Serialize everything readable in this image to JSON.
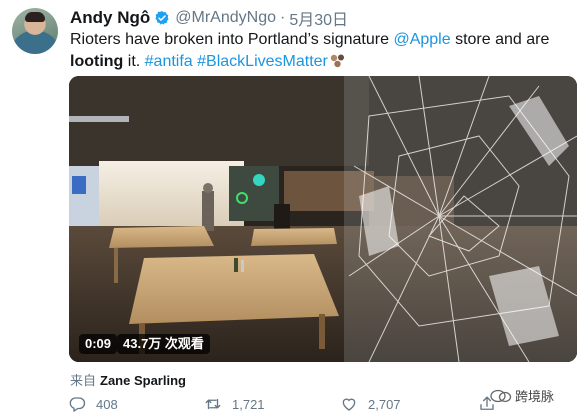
{
  "tweet": {
    "author_name": "Andy Ngô",
    "handle": "@MrAndyNgo",
    "separator": "·",
    "date": "5月30日",
    "text_parts": {
      "p1": "Rioters have broken into Portland’s signature ",
      "mention": "@Apple",
      "p2": " store and are ",
      "bold": "looting",
      "p3": " it. ",
      "hashtag1": "#antifa",
      "hashtag2": "#BlackLivesMatter"
    },
    "video": {
      "time": "0:09",
      "views": "43.7万 次观看"
    },
    "attribution_prefix": "来自",
    "attribution_name": "Zane Sparling",
    "counts": {
      "replies": "408",
      "retweets": "1,721",
      "likes": "2,707"
    }
  },
  "watermark": "跨境脉",
  "colors": {
    "link": "#1b95e0",
    "secondary": "#657786",
    "verified": "#1da1f2"
  },
  "icons": [
    "verified-badge-icon",
    "reply-icon",
    "retweet-icon",
    "like-icon",
    "share-icon",
    "watermark-logo-icon",
    "fist-emoji-icon"
  ]
}
